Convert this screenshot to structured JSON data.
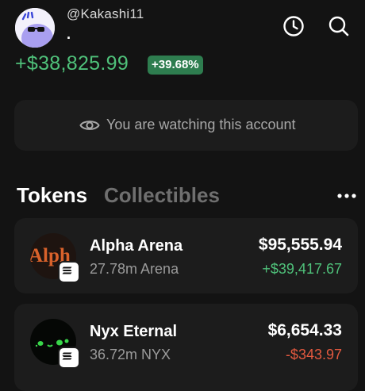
{
  "profile": {
    "username": "@Kakashi11",
    "display_name": ".",
    "pnl_amount": "+$38,825.99",
    "pnl_percent": "+39.68%"
  },
  "header": {
    "history_icon": "clock-icon",
    "search_icon": "search-icon"
  },
  "watch_banner": {
    "icon": "eye-icon",
    "text": "You are watching this account"
  },
  "tabs": [
    {
      "label": "Tokens",
      "active": true
    },
    {
      "label": "Collectibles",
      "active": false
    }
  ],
  "more_icon": "ellipsis-icon",
  "tokens": [
    {
      "name": "Alpha Arena",
      "amount": "27.78m Arena",
      "value": "$95,555.94",
      "change": "+$39,417.67",
      "direction": "up",
      "logo_text": "Alph"
    },
    {
      "name": "Nyx Eternal",
      "amount": "36.72m NYX",
      "value": "$6,654.33",
      "change": "-$343.97",
      "direction": "down"
    }
  ],
  "colors": {
    "background": "#131313",
    "card": "#1c1c1c",
    "positive": "#4fc17a",
    "negative": "#e4593f",
    "badge_bg": "#2e7d4f"
  }
}
